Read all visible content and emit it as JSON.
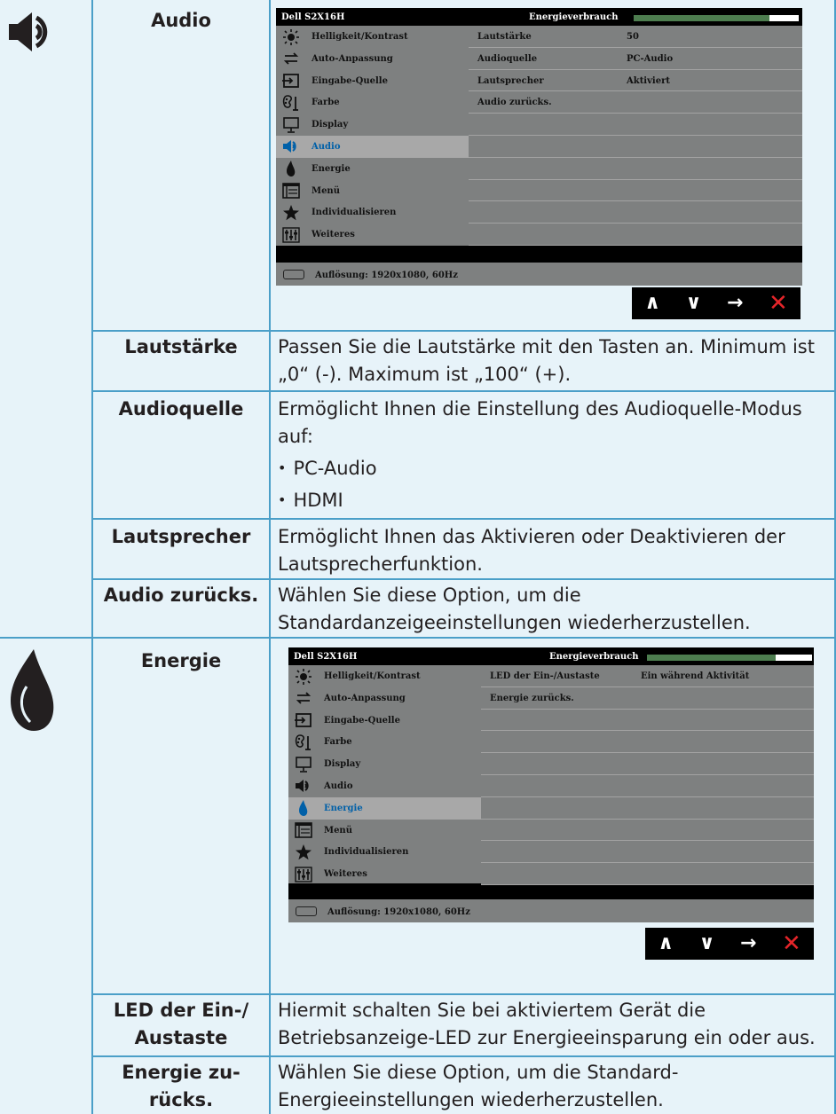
{
  "audio_section": {
    "label": "Audio",
    "osd": {
      "model": "Dell S2X16H",
      "energy_label": "Energieverbrauch",
      "energy_level": 0.82,
      "menu": [
        {
          "label": "Helligkeit/Kontrast",
          "icon": "sun-icon"
        },
        {
          "label": "Auto-Anpassung",
          "icon": "auto-adjust-icon"
        },
        {
          "label": "Eingabe-Quelle",
          "icon": "input-source-icon"
        },
        {
          "label": "Farbe",
          "icon": "color-icon"
        },
        {
          "label": "Display",
          "icon": "display-icon"
        },
        {
          "label": "Audio",
          "icon": "speaker-icon"
        },
        {
          "label": "Energie",
          "icon": "energy-icon"
        },
        {
          "label": "Menü",
          "icon": "menu-icon"
        },
        {
          "label": "Individualisieren",
          "icon": "star-icon"
        },
        {
          "label": "Weiteres",
          "icon": "sliders-icon"
        }
      ],
      "active_index": 5,
      "settings": [
        {
          "key": "Lautstärke",
          "value": "50"
        },
        {
          "key": "Audioquelle",
          "value": "PC-Audio"
        },
        {
          "key": "Lautsprecher",
          "value": "Aktiviert"
        },
        {
          "key": "Audio zurücks.",
          "value": ""
        }
      ],
      "footer": "Auflösung: 1920x1080, 60Hz"
    },
    "rows": [
      {
        "label": "Lautstärke",
        "desc": "Passen Sie die Lautstärke mit den Tasten an. Minimum ist „0“ (-). Maximum ist „100“ (+)."
      },
      {
        "label": "Audioquelle",
        "desc": "Ermöglicht Ihnen die Einstellung des Audioquelle-Modus auf:",
        "bullets": [
          "PC-Audio",
          "HDMI"
        ]
      },
      {
        "label": "Lautsprecher",
        "desc": "Ermöglicht Ihnen das Aktivieren oder Deaktivieren der Lautsprecherfunktion."
      },
      {
        "label": "Audio zurücks.",
        "desc": "Wählen Sie diese Option, um die Standardanzeigeeinstellungen wiederherzustellen."
      }
    ]
  },
  "energy_section": {
    "label": "Energie",
    "osd": {
      "model": "Dell S2X16H",
      "energy_label": "Energieverbrauch",
      "energy_level": 0.78,
      "menu": [
        {
          "label": "Helligkeit/Kontrast",
          "icon": "sun-icon"
        },
        {
          "label": "Auto-Anpassung",
          "icon": "auto-adjust-icon"
        },
        {
          "label": "Eingabe-Quelle",
          "icon": "input-source-icon"
        },
        {
          "label": "Farbe",
          "icon": "color-icon"
        },
        {
          "label": "Display",
          "icon": "display-icon"
        },
        {
          "label": "Audio",
          "icon": "speaker-icon"
        },
        {
          "label": "Energie",
          "icon": "energy-icon"
        },
        {
          "label": "Menü",
          "icon": "menu-icon"
        },
        {
          "label": "Individualisieren",
          "icon": "star-icon"
        },
        {
          "label": "Weiteres",
          "icon": "sliders-icon"
        }
      ],
      "active_index": 6,
      "settings": [
        {
          "key": "LED der Ein-/Austaste",
          "value": "Ein während Aktivität"
        },
        {
          "key": "Energie zurücks.",
          "value": ""
        }
      ],
      "footer": "Auflösung: 1920x1080, 60Hz"
    },
    "rows": [
      {
        "label": "LED der Ein-/\nAustaste",
        "desc": "Hiermit schalten Sie bei aktiviertem Gerät die Betriebsanzeige-LED zur Energieeinsparung ein oder aus."
      },
      {
        "label": "Energie zu-\nrücks.",
        "desc": "Wählen Sie diese Option, um die Standard-Energieeinstellungen wiederherzustellen."
      }
    ]
  },
  "nav_buttons": {
    "up": "∧",
    "down": "∨",
    "enter": "→",
    "exit": "✕"
  },
  "colors": {
    "page_bg": "#e7f3f9",
    "border": "#4b9fc8",
    "osd_bg": "#000000",
    "menu_bg": "#7e8080",
    "active_text": "#0060a8",
    "energy_fill": "#4d7d4f",
    "exit_red": "#e5252a"
  }
}
